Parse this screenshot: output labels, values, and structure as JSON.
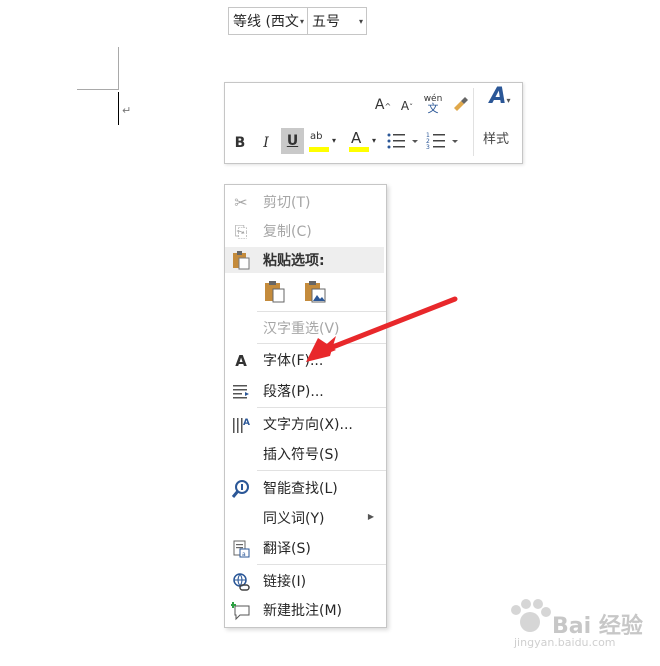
{
  "mini_toolbar": {
    "font_name": "等线 (西文",
    "font_size": "五号",
    "grow_label": "A",
    "shrink_label": "A",
    "phonetic_top": "wén",
    "phonetic_bottom": "文",
    "bold_label": "B",
    "italic_label": "I",
    "underline_label": "U",
    "highlight_label": "ab",
    "font_color_label": "A",
    "styles_label": "样式",
    "styles_icon_label": "A",
    "highlight_color": "#ffff00",
    "font_color": "#ff0000"
  },
  "context_menu": {
    "items": [
      {
        "label": "剪切(T)",
        "icon": "scissors-icon",
        "enabled": false
      },
      {
        "label": "复制(C)",
        "icon": "copy-icon",
        "enabled": false
      },
      {
        "label": "粘贴选项:",
        "icon": "paste-icon",
        "enabled": true
      },
      {
        "label": "汉字重选(V)",
        "icon": "",
        "enabled": false
      },
      {
        "label": "字体(F)...",
        "icon": "font-icon",
        "enabled": true
      },
      {
        "label": "段落(P)...",
        "icon": "paragraph-icon",
        "enabled": true
      },
      {
        "label": "文字方向(X)...",
        "icon": "text-direction-icon",
        "enabled": true
      },
      {
        "label": "插入符号(S)",
        "icon": "",
        "enabled": true
      },
      {
        "label": "智能查找(L)",
        "icon": "smart-lookup-icon",
        "enabled": true
      },
      {
        "label": "同义词(Y)",
        "icon": "",
        "enabled": true
      },
      {
        "label": "翻译(S)",
        "icon": "translate-icon",
        "enabled": true
      },
      {
        "label": "链接(I)",
        "icon": "link-icon",
        "enabled": true
      },
      {
        "label": "新建批注(M)",
        "icon": "new-comment-icon",
        "enabled": true
      }
    ],
    "font_icon_label": "A"
  },
  "annotation": {
    "arrow_color": "#e8282b"
  },
  "watermark": {
    "text": "Bai 经验",
    "url": "jingyan.baidu.com"
  }
}
